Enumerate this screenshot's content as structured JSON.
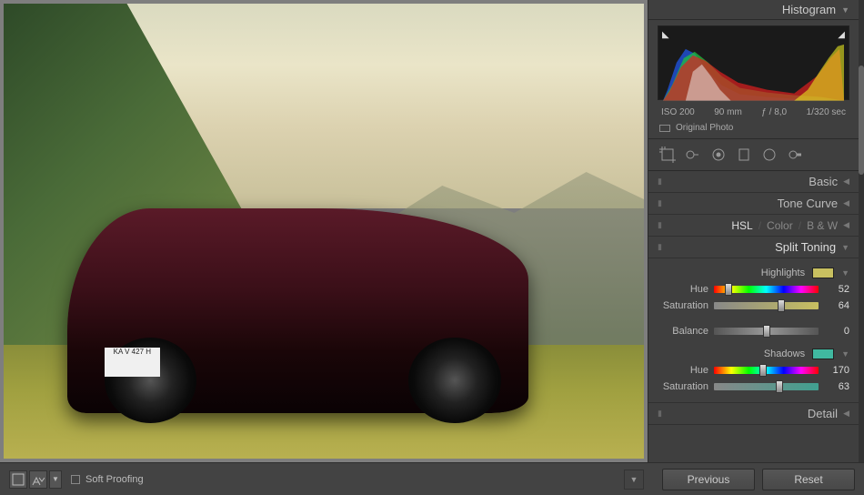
{
  "panel": {
    "header": "Histogram",
    "exif": {
      "iso": "ISO 200",
      "focal": "90 mm",
      "aperture": "ƒ / 8,0",
      "shutter": "1/320 sec"
    },
    "original": "Original Photo",
    "sections": {
      "basic": "Basic",
      "tone": "Tone Curve",
      "hsl": "HSL",
      "color": "Color",
      "bw": "B & W",
      "split": "Split Toning",
      "detail": "Detail"
    }
  },
  "split": {
    "highlights": {
      "title": "Highlights",
      "hueLabel": "Hue",
      "hueVal": "52",
      "huePct": 14,
      "satLabel": "Saturation",
      "satVal": "64",
      "satPct": 64,
      "swatch": "#c8c060"
    },
    "balance": {
      "label": "Balance",
      "val": "0",
      "pct": 50
    },
    "shadows": {
      "title": "Shadows",
      "hueLabel": "Hue",
      "hueVal": "170",
      "huePct": 47,
      "satLabel": "Saturation",
      "satVal": "63",
      "satPct": 63,
      "swatch": "#40b8a0"
    }
  },
  "bottom": {
    "soft": "Soft Proofing",
    "prev": "Previous",
    "reset": "Reset"
  },
  "photo": {
    "plate": "KA V 427 H"
  }
}
